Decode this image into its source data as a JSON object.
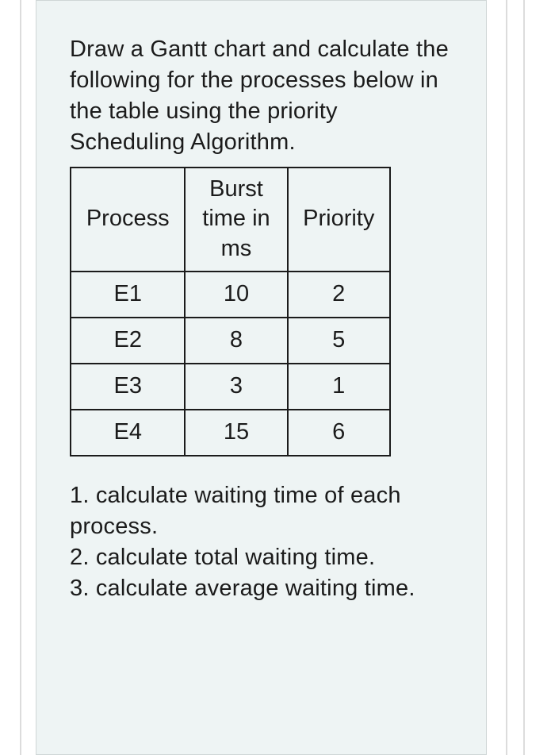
{
  "prompt": "Draw a Gantt chart and calculate the following for the processes below in the table using the priority Scheduling Algorithm.",
  "table": {
    "headers": {
      "process": "Process",
      "burst": "Burst time in ms",
      "priority": "Priority"
    },
    "rows": [
      {
        "process": "E1",
        "burst": "10",
        "priority": "2"
      },
      {
        "process": "E2",
        "burst": "8",
        "priority": "5"
      },
      {
        "process": "E3",
        "burst": "3",
        "priority": "1"
      },
      {
        "process": "E4",
        "burst": "15",
        "priority": "6"
      }
    ]
  },
  "questions": {
    "q1": "1. calculate waiting time of each process.",
    "q2": "2. calculate total waiting time.",
    "q3": "3. calculate average waiting time."
  }
}
